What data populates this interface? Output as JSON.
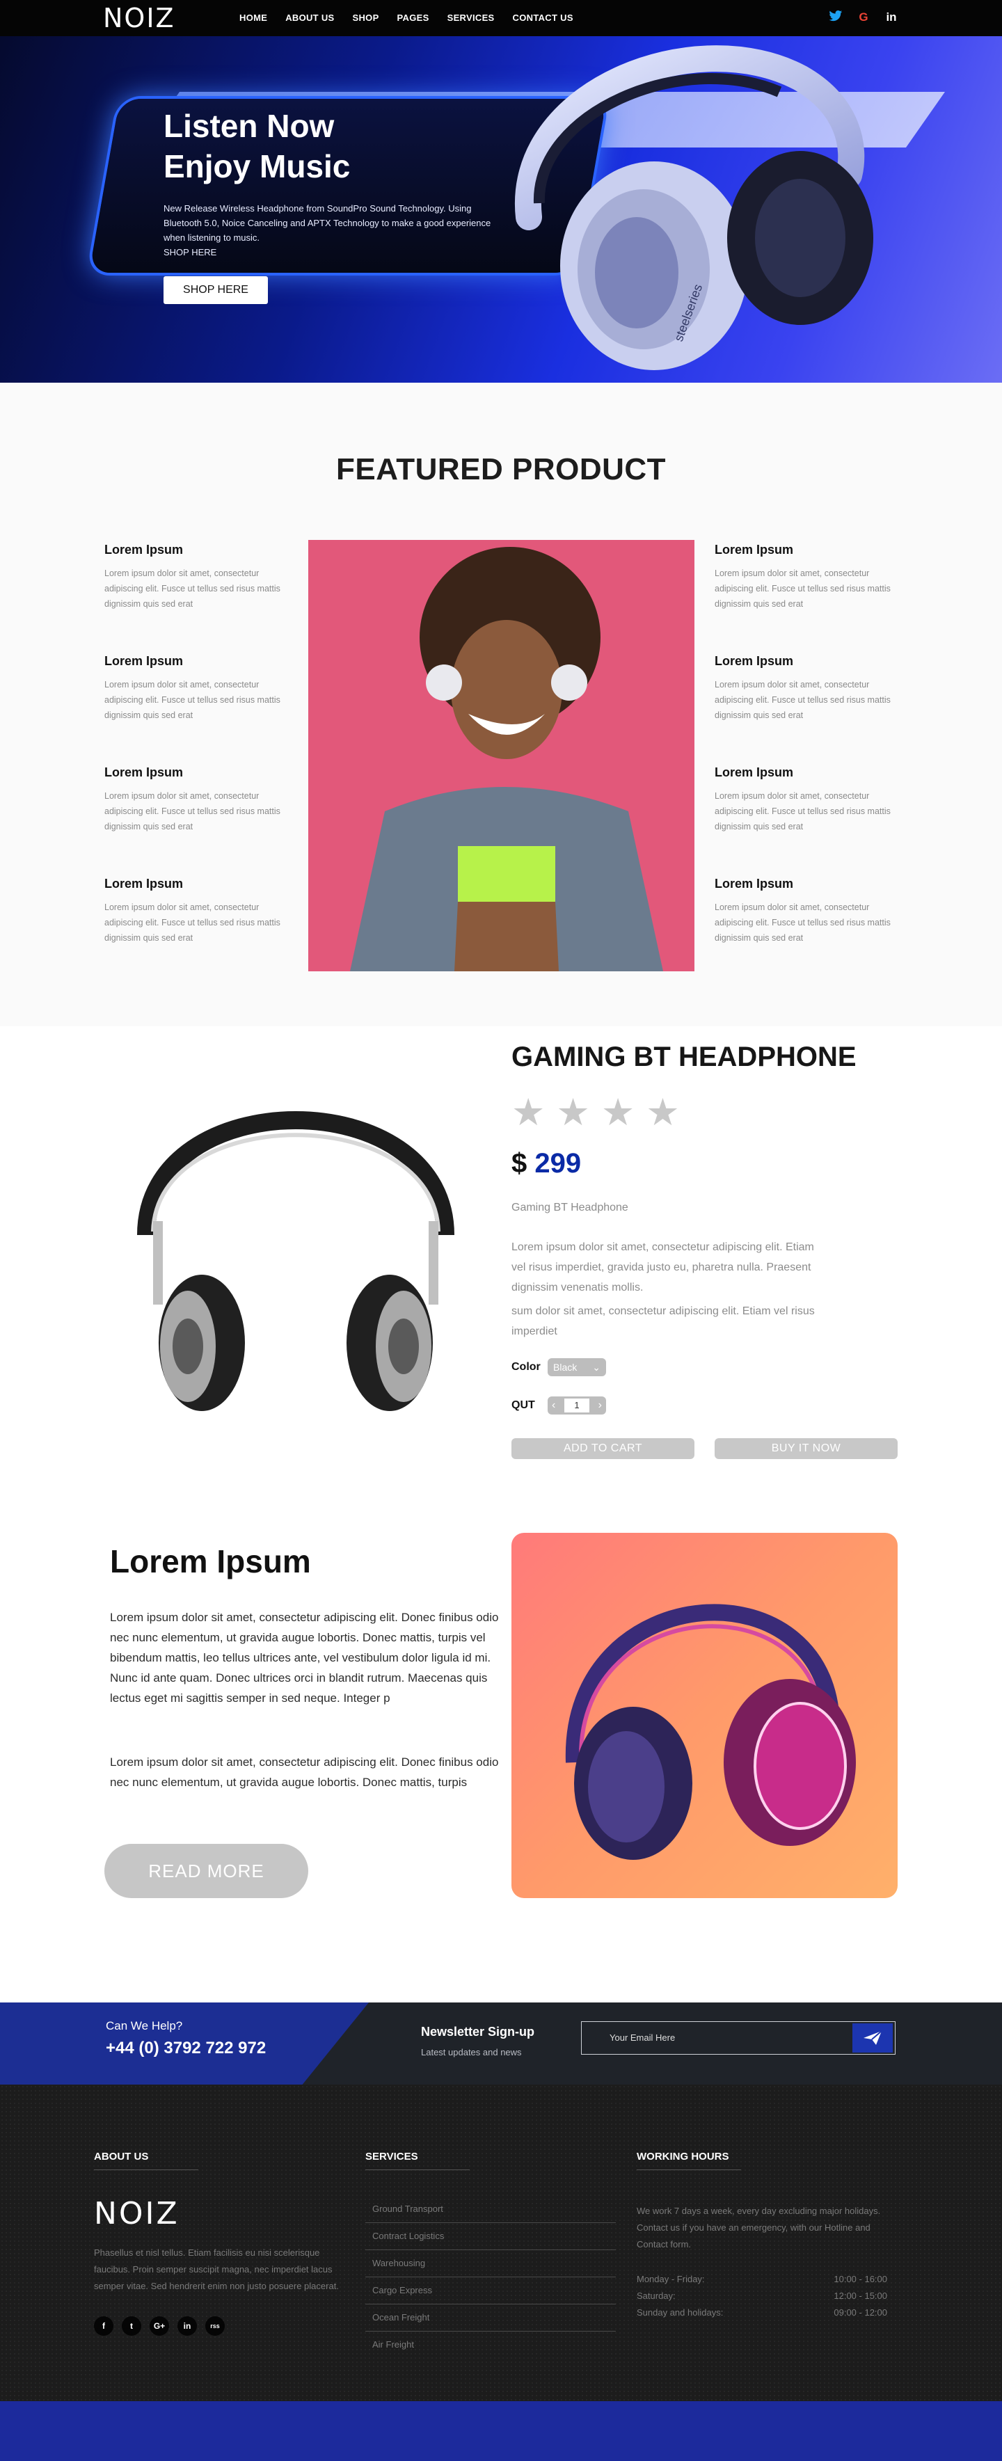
{
  "brand": {
    "logo": "NOIZ"
  },
  "nav": {
    "items": [
      "HOME",
      "ABOUT US",
      "SHOP",
      "PAGES",
      "SERVICES",
      "CONTACT US"
    ],
    "social": {
      "twitter": "t",
      "google": "G",
      "linkedin": "in"
    }
  },
  "hero": {
    "title_line1": "Listen Now",
    "title_line2": "Enjoy Music",
    "text": "New Release Wireless Headphone from SoundPro Sound Technology. Using Bluetooth 5.0, Noice Canceling and APTX Technology to make a good experience when listening to music.",
    "link": "SHOP HERE",
    "button": "SHOP HERE"
  },
  "featured": {
    "title": "FEATURED PRODUCT",
    "items": [
      {
        "title": "Lorem Ipsum",
        "text": "Lorem ipsum dolor sit amet, consectetur adipiscing elit. Fusce ut tellus sed risus mattis dignissim quis sed erat"
      },
      {
        "title": "Lorem Ipsum",
        "text": "Lorem ipsum dolor sit amet, consectetur adipiscing elit. Fusce ut tellus sed risus mattis dignissim quis sed erat"
      },
      {
        "title": "Lorem Ipsum",
        "text": "Lorem ipsum dolor sit amet, consectetur adipiscing elit. Fusce ut tellus sed risus mattis dignissim quis sed erat"
      },
      {
        "title": "Lorem Ipsum",
        "text": "Lorem ipsum dolor sit amet, consectetur adipiscing elit. Fusce ut tellus sed risus mattis dignissim quis sed erat"
      },
      {
        "title": "Lorem Ipsum",
        "text": "Lorem ipsum dolor sit amet, consectetur adipiscing elit. Fusce ut tellus sed risus mattis dignissim quis sed erat"
      },
      {
        "title": "Lorem Ipsum",
        "text": "Lorem ipsum dolor sit amet, consectetur adipiscing elit. Fusce ut tellus sed risus mattis dignissim quis sed erat"
      },
      {
        "title": "Lorem Ipsum",
        "text": "Lorem ipsum dolor sit amet, consectetur adipiscing elit. Fusce ut tellus sed risus mattis dignissim quis sed erat"
      },
      {
        "title": "Lorem Ipsum",
        "text": "Lorem ipsum dolor sit amet, consectetur adipiscing elit. Fusce ut tellus sed risus mattis dignissim quis sed erat"
      }
    ]
  },
  "product": {
    "title": "GAMING BT HEADPHONE",
    "rating_stars": 4,
    "currency": "$",
    "price": "299",
    "subname": "Gaming BT Headphone",
    "desc1": "Lorem ipsum dolor sit amet, consectetur adipiscing elit. Etiam vel risus imperdiet, gravida justo eu, pharetra nulla. Praesent dignissim venenatis mollis.",
    "desc2": "sum dolor sit amet, consectetur adipiscing elit. Etiam vel risus imperdiet",
    "color_label": "Color",
    "color_value": "Black",
    "qty_label": "QUT",
    "qty_value": "1",
    "add_to_cart": "ADD TO CART",
    "buy_now": "BUY IT NOW"
  },
  "about": {
    "title": "Lorem Ipsum",
    "p1": "Lorem ipsum dolor sit amet, consectetur adipiscing elit. Donec finibus odio nec nunc elementum, ut gravida augue lobortis. Donec mattis, turpis vel bibendum mattis, leo tellus ultrices ante, vel vestibulum dolor ligula id mi. Nunc id ante quam. Donec ultrices orci in blandit rutrum. Maecenas quis lectus eget mi sagittis semper in sed neque. Integer p",
    "p2": "Lorem ipsum dolor sit amet, consectetur adipiscing elit. Donec finibus odio nec nunc elementum, ut gravida augue lobortis. Donec mattis, turpis",
    "button": "READ MORE"
  },
  "contact": {
    "help": "Can We Help?",
    "phone": "+44 (0) 3792 722 972",
    "newsletter": "Newsletter Sign-up",
    "newsletter_sub": "Latest updates and news",
    "email_placeholder": "Your Email Here"
  },
  "footer": {
    "about_heading": "ABOUT US",
    "logo": "NOIZ",
    "about_text": "Phasellus et nisl tellus. Etiam facilisis eu nisi scelerisque faucibus. Proin semper suscipit magna, nec imperdiet lacus semper vitae. Sed hendrerit enim non justo posuere placerat.",
    "social": [
      "f",
      "t",
      "G+",
      "in",
      "rss"
    ],
    "services_heading": "SERVICES",
    "services": [
      "Ground Transport",
      "Contract Logistics",
      "Warehousing",
      "Cargo Express",
      "Ocean Freight",
      "Air Freight"
    ],
    "hours_heading": "WORKING HOURS",
    "hours_text": "We work 7 days a week, every day excluding major holidays. Contact us if you have an emergency, with our Hotline and Contact form.",
    "hours": [
      {
        "day": "Monday - Friday:",
        "time": "10:00 - 16:00"
      },
      {
        "day": "Saturday:",
        "time": "12:00 - 15:00"
      },
      {
        "day": "Sunday and holidays:",
        "time": "09:00 - 12:00"
      }
    ]
  },
  "colors": {
    "accent": "#0a2aa6",
    "brand_blue": "#1c2e93"
  }
}
